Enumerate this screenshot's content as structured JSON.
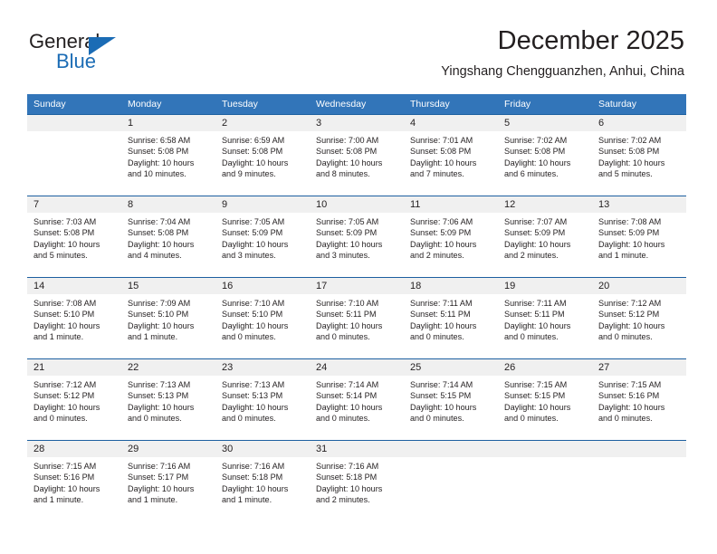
{
  "brand": {
    "name_part1": "General",
    "name_part2": "Blue"
  },
  "header": {
    "title": "December 2025",
    "subtitle": "Yingshang Chengguanzhen, Anhui, China"
  },
  "colors": {
    "header_blue": "#3275b9",
    "cell_border_blue": "#1c5fa0",
    "daynum_band": "#f0f0f0",
    "brand_blue": "#1b6cb5",
    "text": "#231f20"
  },
  "weekday_headers": [
    "Sunday",
    "Monday",
    "Tuesday",
    "Wednesday",
    "Thursday",
    "Friday",
    "Saturday"
  ],
  "weeks": [
    [
      {
        "day": "",
        "sunrise": "",
        "sunset": "",
        "daylight_line1": "",
        "daylight_line2": ""
      },
      {
        "day": "1",
        "sunrise": "Sunrise: 6:58 AM",
        "sunset": "Sunset: 5:08 PM",
        "daylight_line1": "Daylight: 10 hours",
        "daylight_line2": "and 10 minutes."
      },
      {
        "day": "2",
        "sunrise": "Sunrise: 6:59 AM",
        "sunset": "Sunset: 5:08 PM",
        "daylight_line1": "Daylight: 10 hours",
        "daylight_line2": "and 9 minutes."
      },
      {
        "day": "3",
        "sunrise": "Sunrise: 7:00 AM",
        "sunset": "Sunset: 5:08 PM",
        "daylight_line1": "Daylight: 10 hours",
        "daylight_line2": "and 8 minutes."
      },
      {
        "day": "4",
        "sunrise": "Sunrise: 7:01 AM",
        "sunset": "Sunset: 5:08 PM",
        "daylight_line1": "Daylight: 10 hours",
        "daylight_line2": "and 7 minutes."
      },
      {
        "day": "5",
        "sunrise": "Sunrise: 7:02 AM",
        "sunset": "Sunset: 5:08 PM",
        "daylight_line1": "Daylight: 10 hours",
        "daylight_line2": "and 6 minutes."
      },
      {
        "day": "6",
        "sunrise": "Sunrise: 7:02 AM",
        "sunset": "Sunset: 5:08 PM",
        "daylight_line1": "Daylight: 10 hours",
        "daylight_line2": "and 5 minutes."
      }
    ],
    [
      {
        "day": "7",
        "sunrise": "Sunrise: 7:03 AM",
        "sunset": "Sunset: 5:08 PM",
        "daylight_line1": "Daylight: 10 hours",
        "daylight_line2": "and 5 minutes."
      },
      {
        "day": "8",
        "sunrise": "Sunrise: 7:04 AM",
        "sunset": "Sunset: 5:08 PM",
        "daylight_line1": "Daylight: 10 hours",
        "daylight_line2": "and 4 minutes."
      },
      {
        "day": "9",
        "sunrise": "Sunrise: 7:05 AM",
        "sunset": "Sunset: 5:09 PM",
        "daylight_line1": "Daylight: 10 hours",
        "daylight_line2": "and 3 minutes."
      },
      {
        "day": "10",
        "sunrise": "Sunrise: 7:05 AM",
        "sunset": "Sunset: 5:09 PM",
        "daylight_line1": "Daylight: 10 hours",
        "daylight_line2": "and 3 minutes."
      },
      {
        "day": "11",
        "sunrise": "Sunrise: 7:06 AM",
        "sunset": "Sunset: 5:09 PM",
        "daylight_line1": "Daylight: 10 hours",
        "daylight_line2": "and 2 minutes."
      },
      {
        "day": "12",
        "sunrise": "Sunrise: 7:07 AM",
        "sunset": "Sunset: 5:09 PM",
        "daylight_line1": "Daylight: 10 hours",
        "daylight_line2": "and 2 minutes."
      },
      {
        "day": "13",
        "sunrise": "Sunrise: 7:08 AM",
        "sunset": "Sunset: 5:09 PM",
        "daylight_line1": "Daylight: 10 hours",
        "daylight_line2": "and 1 minute."
      }
    ],
    [
      {
        "day": "14",
        "sunrise": "Sunrise: 7:08 AM",
        "sunset": "Sunset: 5:10 PM",
        "daylight_line1": "Daylight: 10 hours",
        "daylight_line2": "and 1 minute."
      },
      {
        "day": "15",
        "sunrise": "Sunrise: 7:09 AM",
        "sunset": "Sunset: 5:10 PM",
        "daylight_line1": "Daylight: 10 hours",
        "daylight_line2": "and 1 minute."
      },
      {
        "day": "16",
        "sunrise": "Sunrise: 7:10 AM",
        "sunset": "Sunset: 5:10 PM",
        "daylight_line1": "Daylight: 10 hours",
        "daylight_line2": "and 0 minutes."
      },
      {
        "day": "17",
        "sunrise": "Sunrise: 7:10 AM",
        "sunset": "Sunset: 5:11 PM",
        "daylight_line1": "Daylight: 10 hours",
        "daylight_line2": "and 0 minutes."
      },
      {
        "day": "18",
        "sunrise": "Sunrise: 7:11 AM",
        "sunset": "Sunset: 5:11 PM",
        "daylight_line1": "Daylight: 10 hours",
        "daylight_line2": "and 0 minutes."
      },
      {
        "day": "19",
        "sunrise": "Sunrise: 7:11 AM",
        "sunset": "Sunset: 5:11 PM",
        "daylight_line1": "Daylight: 10 hours",
        "daylight_line2": "and 0 minutes."
      },
      {
        "day": "20",
        "sunrise": "Sunrise: 7:12 AM",
        "sunset": "Sunset: 5:12 PM",
        "daylight_line1": "Daylight: 10 hours",
        "daylight_line2": "and 0 minutes."
      }
    ],
    [
      {
        "day": "21",
        "sunrise": "Sunrise: 7:12 AM",
        "sunset": "Sunset: 5:12 PM",
        "daylight_line1": "Daylight: 10 hours",
        "daylight_line2": "and 0 minutes."
      },
      {
        "day": "22",
        "sunrise": "Sunrise: 7:13 AM",
        "sunset": "Sunset: 5:13 PM",
        "daylight_line1": "Daylight: 10 hours",
        "daylight_line2": "and 0 minutes."
      },
      {
        "day": "23",
        "sunrise": "Sunrise: 7:13 AM",
        "sunset": "Sunset: 5:13 PM",
        "daylight_line1": "Daylight: 10 hours",
        "daylight_line2": "and 0 minutes."
      },
      {
        "day": "24",
        "sunrise": "Sunrise: 7:14 AM",
        "sunset": "Sunset: 5:14 PM",
        "daylight_line1": "Daylight: 10 hours",
        "daylight_line2": "and 0 minutes."
      },
      {
        "day": "25",
        "sunrise": "Sunrise: 7:14 AM",
        "sunset": "Sunset: 5:15 PM",
        "daylight_line1": "Daylight: 10 hours",
        "daylight_line2": "and 0 minutes."
      },
      {
        "day": "26",
        "sunrise": "Sunrise: 7:15 AM",
        "sunset": "Sunset: 5:15 PM",
        "daylight_line1": "Daylight: 10 hours",
        "daylight_line2": "and 0 minutes."
      },
      {
        "day": "27",
        "sunrise": "Sunrise: 7:15 AM",
        "sunset": "Sunset: 5:16 PM",
        "daylight_line1": "Daylight: 10 hours",
        "daylight_line2": "and 0 minutes."
      }
    ],
    [
      {
        "day": "28",
        "sunrise": "Sunrise: 7:15 AM",
        "sunset": "Sunset: 5:16 PM",
        "daylight_line1": "Daylight: 10 hours",
        "daylight_line2": "and 1 minute."
      },
      {
        "day": "29",
        "sunrise": "Sunrise: 7:16 AM",
        "sunset": "Sunset: 5:17 PM",
        "daylight_line1": "Daylight: 10 hours",
        "daylight_line2": "and 1 minute."
      },
      {
        "day": "30",
        "sunrise": "Sunrise: 7:16 AM",
        "sunset": "Sunset: 5:18 PM",
        "daylight_line1": "Daylight: 10 hours",
        "daylight_line2": "and 1 minute."
      },
      {
        "day": "31",
        "sunrise": "Sunrise: 7:16 AM",
        "sunset": "Sunset: 5:18 PM",
        "daylight_line1": "Daylight: 10 hours",
        "daylight_line2": "and 2 minutes."
      },
      {
        "day": "",
        "sunrise": "",
        "sunset": "",
        "daylight_line1": "",
        "daylight_line2": ""
      },
      {
        "day": "",
        "sunrise": "",
        "sunset": "",
        "daylight_line1": "",
        "daylight_line2": ""
      },
      {
        "day": "",
        "sunrise": "",
        "sunset": "",
        "daylight_line1": "",
        "daylight_line2": ""
      }
    ]
  ]
}
